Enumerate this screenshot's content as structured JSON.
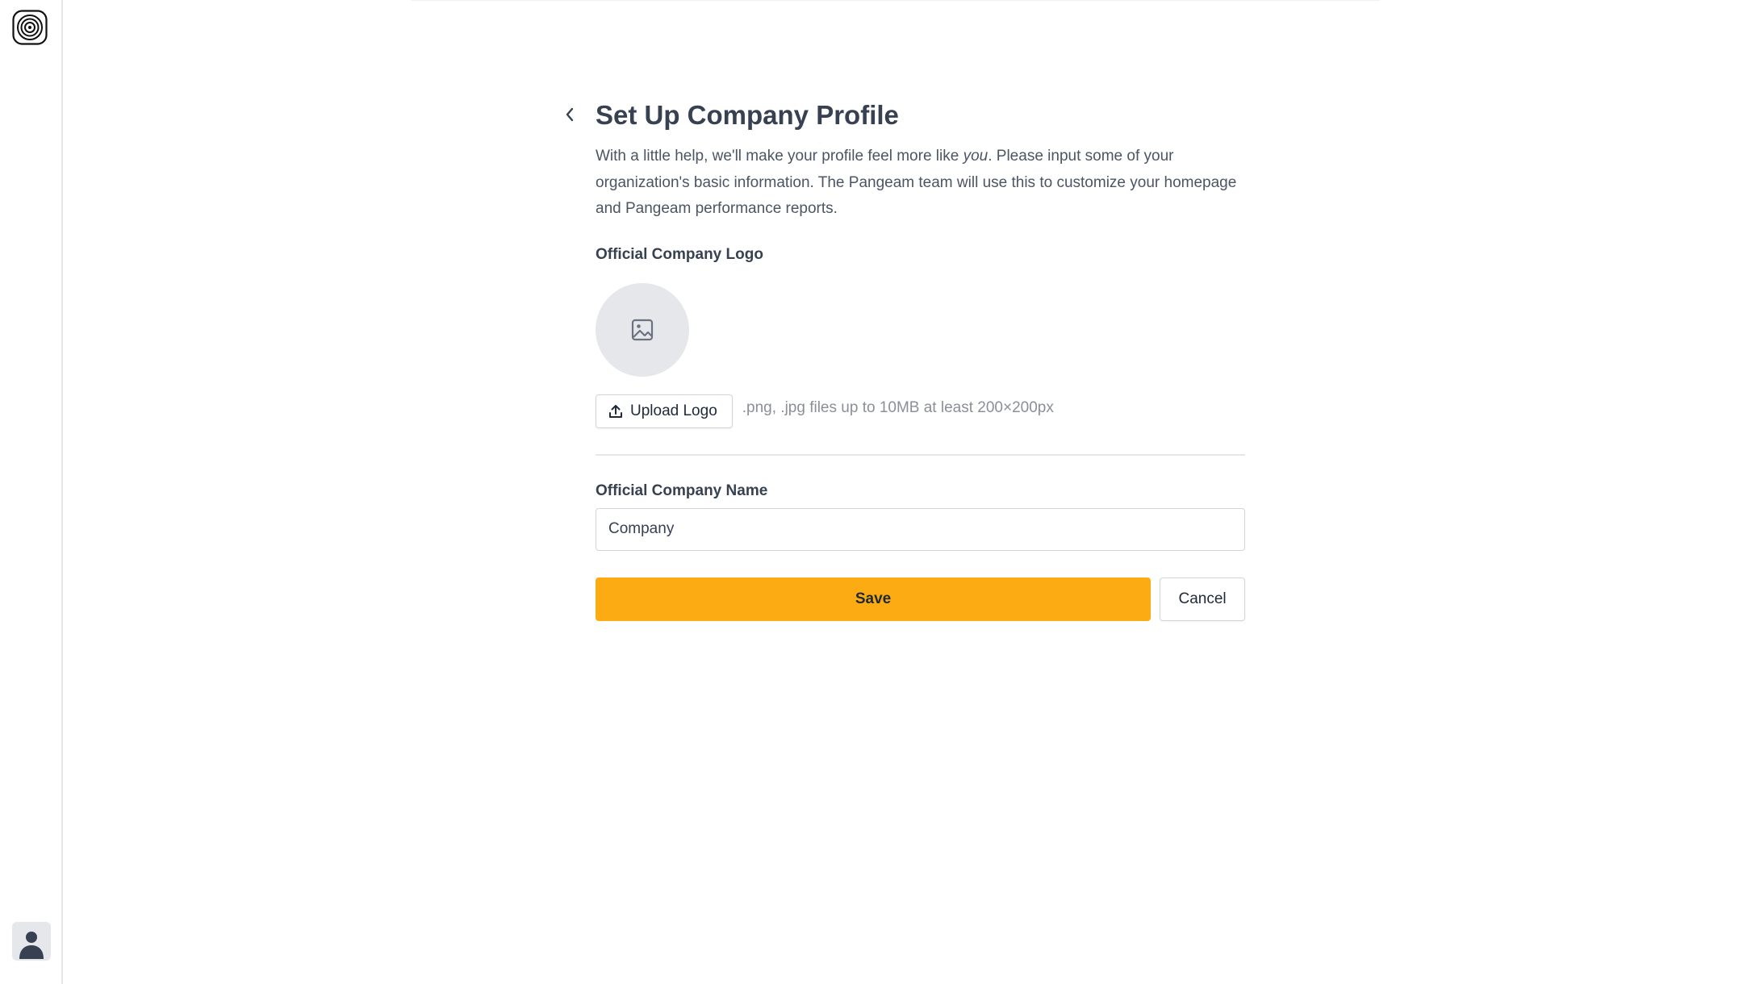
{
  "sidebar": {
    "logo_icon": "concentric-circles-logo-icon",
    "avatar_icon": "user-avatar-icon"
  },
  "page": {
    "back_icon": "chevron-left-icon",
    "title": "Set Up Company Profile",
    "description_before": "With a little help, we'll make your profile feel more like ",
    "description_emphasis": "you",
    "description_after": ". Please input some of your organization's basic information. The Pangeam team will use this to customize your homepage and Pangeam performance reports."
  },
  "logo_section": {
    "label": "Official Company Logo",
    "preview_icon": "image-icon",
    "upload_icon": "upload-icon",
    "upload_label": "Upload Logo",
    "hint": ".png, .jpg files up to 10MB at least 200×200px"
  },
  "name_section": {
    "label": "Official Company Name",
    "value": "Company"
  },
  "actions": {
    "save_label": "Save",
    "cancel_label": "Cancel"
  },
  "colors": {
    "accent": "#fcac12",
    "text": "#374151",
    "muted": "#8a8f98",
    "border": "#d1d5db"
  }
}
